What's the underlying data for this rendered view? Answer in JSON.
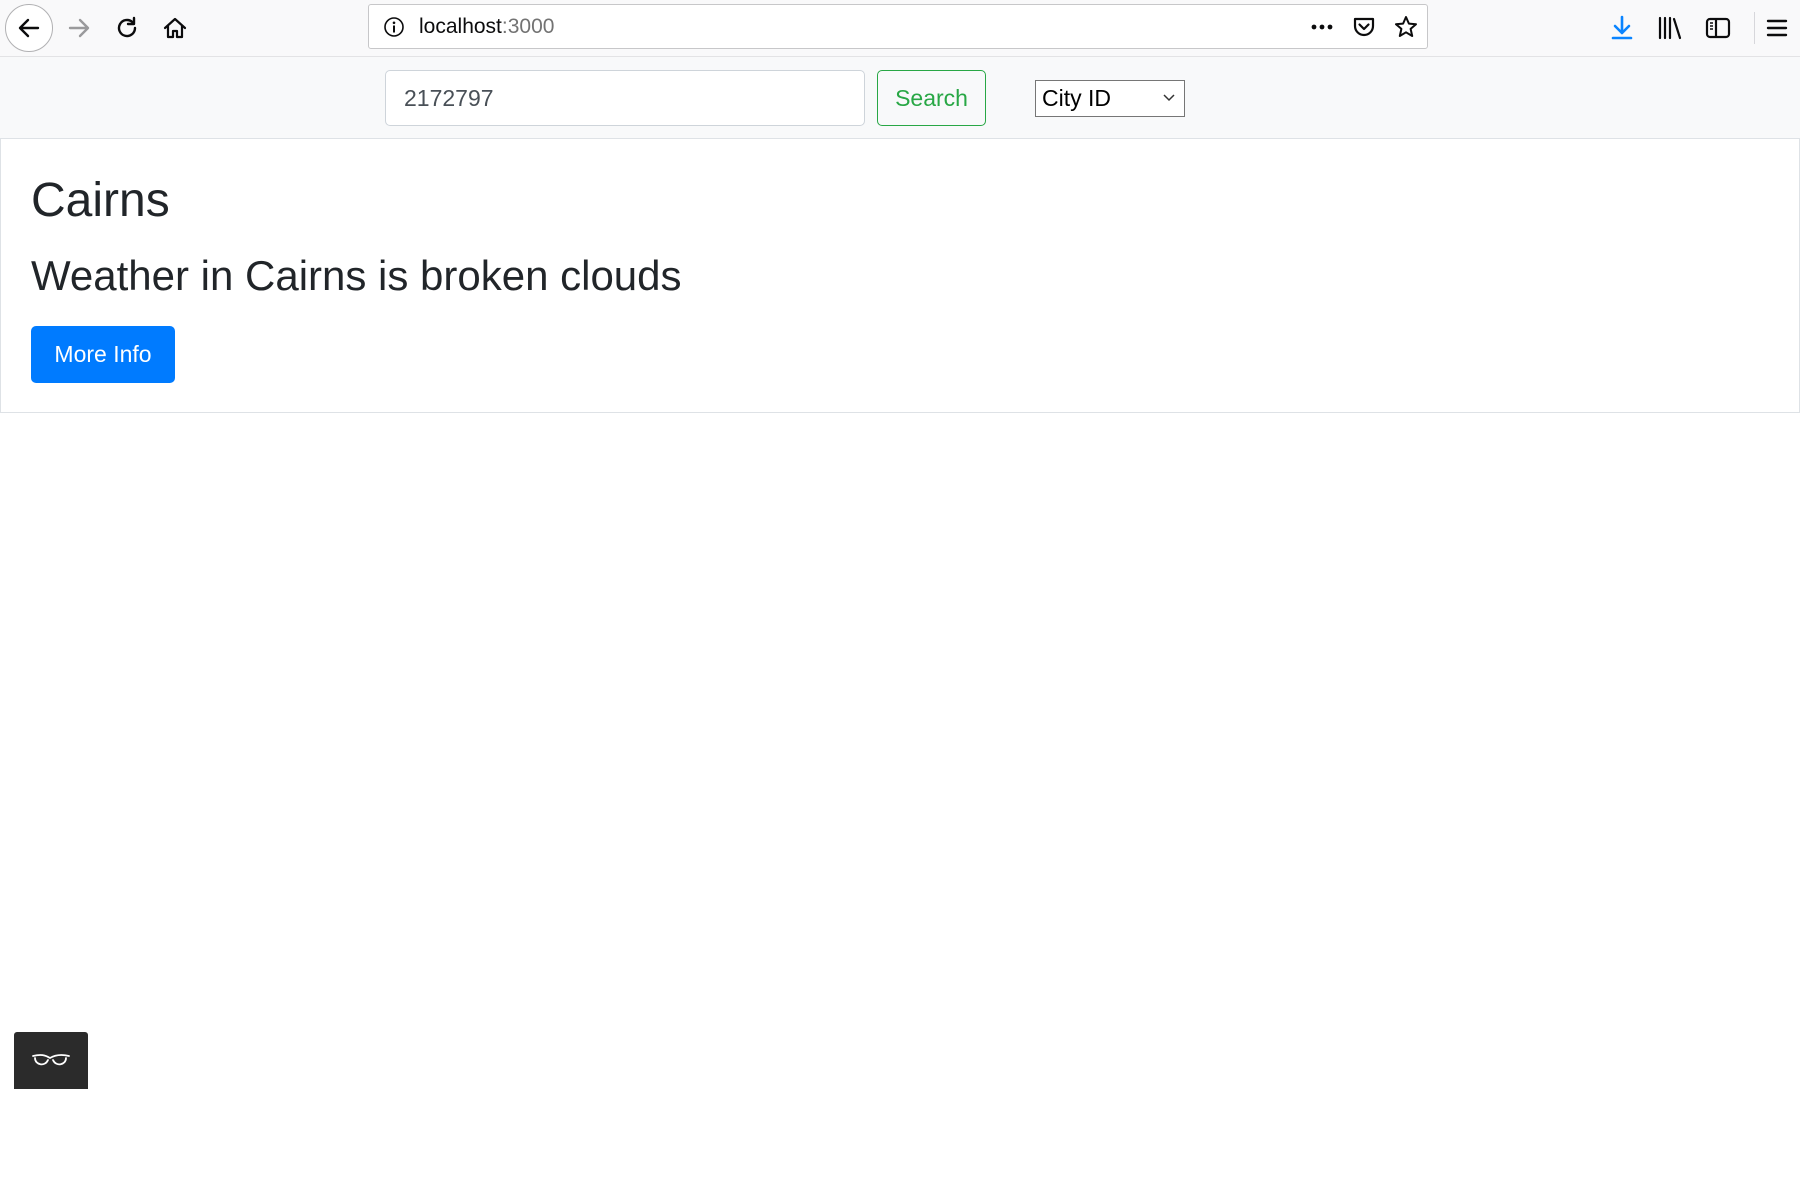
{
  "browser": {
    "url_host": "localhost",
    "url_port": ":3000",
    "icons": {
      "back": "back-arrow-icon",
      "forward": "forward-arrow-icon",
      "reload": "reload-icon",
      "home": "home-icon",
      "info": "info-icon",
      "page_actions": "ellipsis-icon",
      "pocket": "pocket-icon",
      "bookmark": "star-icon",
      "downloads": "download-icon",
      "library": "library-icon",
      "sidebar": "sidebar-icon",
      "menu": "hamburger-menu-icon"
    },
    "accent_color": "#0a84ff"
  },
  "navbar": {
    "search_value": "2172797",
    "search_button_label": "Search",
    "search_type_selected": "City ID",
    "search_button_color": "#28a745"
  },
  "card": {
    "city_name": "Cairns",
    "weather_text": "Weather in Cairns is broken clouds",
    "more_info_label": "More Info",
    "button_color": "#007bff"
  },
  "overlay": {
    "icon": "glasses-icon"
  }
}
